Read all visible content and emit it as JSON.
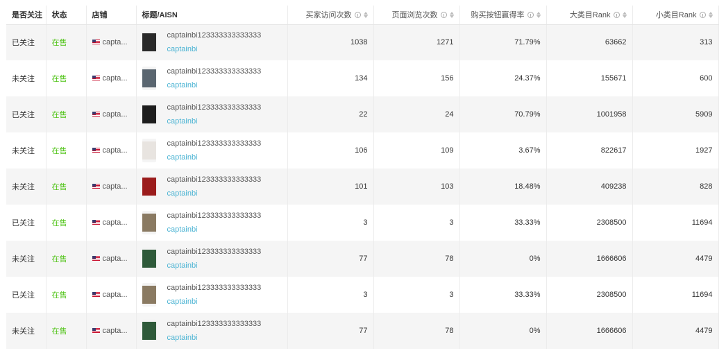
{
  "columns": {
    "followed": "是否关注",
    "status": "状态",
    "store": "店铺",
    "title": "标题/AISN",
    "buyer_visits": "买家访问次数",
    "page_views": "页面浏览次数",
    "buy_box_rate": "购买按钮赢得率",
    "main_rank": "大类目Rank",
    "sub_rank": "小类目Rank"
  },
  "rows": [
    {
      "followed": "已关注",
      "status": "在售",
      "store": "capta...",
      "title": "captainbi123333333333333",
      "asin": "captainbi",
      "thumb_color": "#2a2a2a",
      "buyer_visits": "1038",
      "page_views": "1271",
      "buy_box_rate": "71.79%",
      "main_rank": "63662",
      "sub_rank": "313"
    },
    {
      "followed": "未关注",
      "status": "在售",
      "store": "capta...",
      "title": "captainbi123333333333333",
      "asin": "captainbi",
      "thumb_color": "#5a6670",
      "buyer_visits": "134",
      "page_views": "156",
      "buy_box_rate": "24.37%",
      "main_rank": "155671",
      "sub_rank": "600"
    },
    {
      "followed": "已关注",
      "status": "在售",
      "store": "capta...",
      "title": "captainbi123333333333333",
      "asin": "captainbi",
      "thumb_color": "#1e1e1e",
      "buyer_visits": "22",
      "page_views": "24",
      "buy_box_rate": "70.79%",
      "main_rank": "1001958",
      "sub_rank": "5909"
    },
    {
      "followed": "未关注",
      "status": "在售",
      "store": "capta...",
      "title": "captainbi123333333333333",
      "asin": "captainbi",
      "thumb_color": "#e8e4e0",
      "buyer_visits": "106",
      "page_views": "109",
      "buy_box_rate": "3.67%",
      "main_rank": "822617",
      "sub_rank": "1927"
    },
    {
      "followed": "未关注",
      "status": "在售",
      "store": "capta...",
      "title": "captainbi123333333333333",
      "asin": "captainbi",
      "thumb_color": "#9b1c1c",
      "buyer_visits": "101",
      "page_views": "103",
      "buy_box_rate": "18.48%",
      "main_rank": "409238",
      "sub_rank": "828"
    },
    {
      "followed": "已关注",
      "status": "在售",
      "store": "capta...",
      "title": "captainbi123333333333333",
      "asin": "captainbi",
      "thumb_color": "#8a7a62",
      "buyer_visits": "3",
      "page_views": "3",
      "buy_box_rate": "33.33%",
      "main_rank": "2308500",
      "sub_rank": "11694"
    },
    {
      "followed": "未关注",
      "status": "在售",
      "store": "capta...",
      "title": "captainbi123333333333333",
      "asin": "captainbi",
      "thumb_color": "#2f5a3a",
      "buyer_visits": "77",
      "page_views": "78",
      "buy_box_rate": "0%",
      "main_rank": "1666606",
      "sub_rank": "4479"
    },
    {
      "followed": "已关注",
      "status": "在售",
      "store": "capta...",
      "title": "captainbi123333333333333",
      "asin": "captainbi",
      "thumb_color": "#8a7a62",
      "buyer_visits": "3",
      "page_views": "3",
      "buy_box_rate": "33.33%",
      "main_rank": "2308500",
      "sub_rank": "11694"
    },
    {
      "followed": "未关注",
      "status": "在售",
      "store": "capta...",
      "title": "captainbi123333333333333",
      "asin": "captainbi",
      "thumb_color": "#2f5a3a",
      "buyer_visits": "77",
      "page_views": "78",
      "buy_box_rate": "0%",
      "main_rank": "1666606",
      "sub_rank": "4479"
    }
  ]
}
